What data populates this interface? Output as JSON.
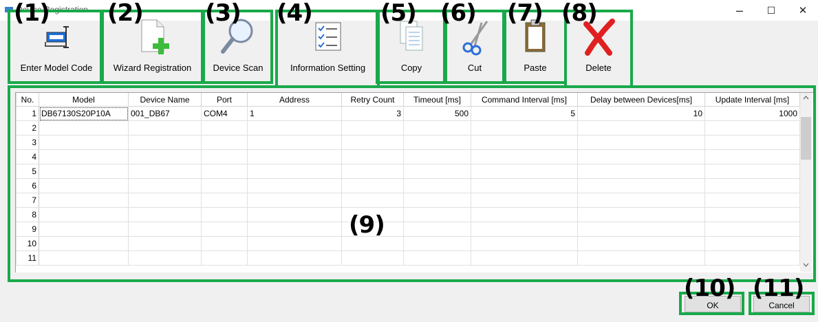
{
  "window": {
    "title": "Device Registration",
    "minimize": "–",
    "maximize": "☐",
    "close": "✕"
  },
  "toolbar": {
    "enter_model_code": "Enter Model Code",
    "wizard_registration": "Wizard Registration",
    "device_scan": "Device Scan",
    "information_setting": "Information Setting",
    "copy": "Copy",
    "cut": "Cut",
    "paste": "Paste",
    "delete": "Delete"
  },
  "callouts": [
    "(1)",
    "(2)",
    "(3)",
    "(4)",
    "(5)",
    "(6)",
    "(7)",
    "(8)",
    "(9)",
    "(10)",
    "(11)"
  ],
  "grid": {
    "columns": [
      "No.",
      "Model",
      "Device Name",
      "Port",
      "Address",
      "Retry Count",
      "Timeout [ms]",
      "Command Interval [ms]",
      "Delay between Devices[ms]",
      "Update Interval [ms]"
    ],
    "row_numbers": [
      "1",
      "2",
      "3",
      "4",
      "5",
      "6",
      "7",
      "8",
      "9",
      "10",
      "11"
    ],
    "row1": {
      "model": "DB67130S20P10A",
      "device_name": "001_DB67",
      "port": "COM4",
      "address": "1",
      "retry_count": "3",
      "timeout": "500",
      "command_interval": "5",
      "delay_between_devices": "10",
      "update_interval": "1000"
    }
  },
  "buttons": {
    "ok": "OK",
    "cancel": "Cancel"
  },
  "colors": {
    "annotation_green": "#19a94a",
    "delete_red": "#e02020",
    "plus_green": "#3dbb3d"
  }
}
